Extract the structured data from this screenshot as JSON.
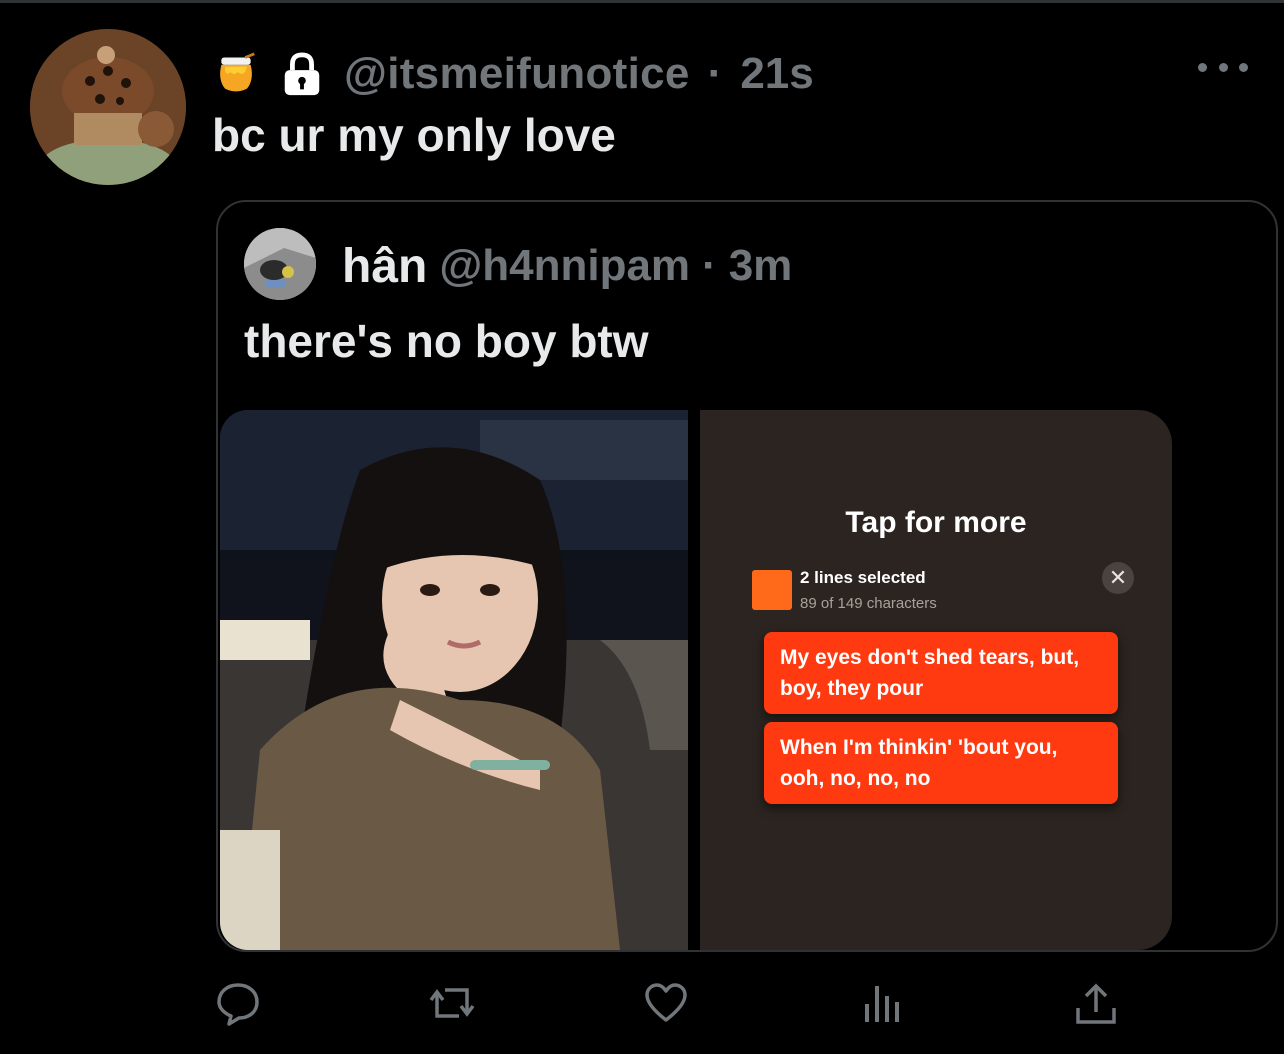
{
  "tweet": {
    "author_handle": "@itsmeifunotice",
    "separator": "·",
    "time": "21s",
    "text": "bc ur my only love",
    "badges": [
      "honey-pot-icon",
      "lock-icon"
    ]
  },
  "quoted_tweet": {
    "author_name": "hân",
    "author_handle": "@h4nnipam",
    "separator": "·",
    "time": "3m",
    "text": "there's no boy btw"
  },
  "lyrics_card": {
    "tap_for_more": "Tap for more",
    "selection_title": "2 lines selected",
    "selection_sub": "89 of 149 characters",
    "close_symbol": "✕",
    "lines": [
      "My eyes don't shed tears, but, boy, they pour",
      "When I'm thinkin' 'bout you, ooh, no, no, no"
    ]
  },
  "actions": [
    "reply-icon",
    "retweet-icon",
    "like-icon",
    "views-icon",
    "share-icon"
  ],
  "colors": {
    "background": "#000000",
    "primary_text": "#e7e9ea",
    "secondary_text": "#71767b",
    "border": "#2f3336",
    "lyric_accent": "#ff3a10",
    "lyric_panel": "#2b2420"
  }
}
